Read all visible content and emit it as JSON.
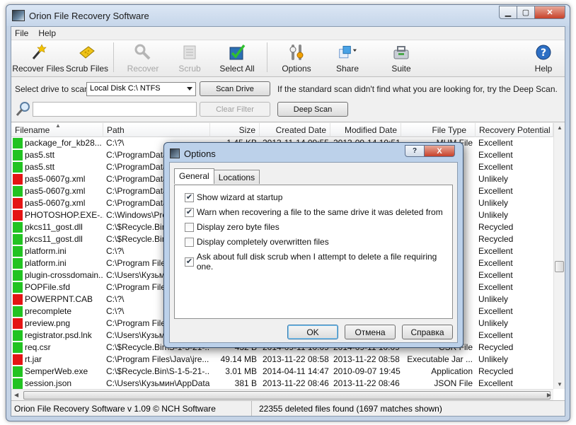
{
  "window": {
    "title": "Orion File Recovery Software"
  },
  "menu": [
    "File",
    "Help"
  ],
  "toolbar": {
    "recover_files": "Recover Files",
    "scrub_files": "Scrub Files",
    "recover": "Recover",
    "scrub": "Scrub",
    "select_all": "Select All",
    "options": "Options",
    "share": "Share",
    "suite": "Suite",
    "help": "Help"
  },
  "scan": {
    "drive_label": "Select drive to scan:",
    "drive_value": "Local Disk C:\\ NTFS",
    "scan_drive": "Scan Drive",
    "hint": "If the standard scan didn't find what you are looking for, try the Deep Scan.",
    "clear_filter": "Clear Filter",
    "deep_scan": "Deep Scan"
  },
  "table": {
    "columns": [
      "Filename",
      "Path",
      "Size",
      "Created Date",
      "Modified Date",
      "File Type",
      "Recovery Potential"
    ],
    "rows": [
      {
        "status": "green",
        "name": "package_for_kb28...",
        "path": "C:\\?\\",
        "size": "1.45 KB",
        "created": "2013-11-14 09:55",
        "modified": "2013-09-14 10:51",
        "type": "MUM File",
        "potential": "Excellent"
      },
      {
        "status": "green",
        "name": "pas5.stt",
        "path": "C:\\ProgramData",
        "size": "",
        "created": "",
        "modified": "",
        "type": "",
        "potential": "Excellent"
      },
      {
        "status": "green",
        "name": "pas5.stt",
        "path": "C:\\ProgramData",
        "size": "",
        "created": "",
        "modified": "",
        "type": "",
        "potential": "Excellent"
      },
      {
        "status": "red",
        "name": "pas5-0607g.xml",
        "path": "C:\\ProgramData",
        "size": "",
        "created": "",
        "modified": "",
        "type": "",
        "potential": "Unlikely"
      },
      {
        "status": "green",
        "name": "pas5-0607g.xml",
        "path": "C:\\ProgramData",
        "size": "",
        "created": "",
        "modified": "",
        "type": "",
        "potential": "Excellent"
      },
      {
        "status": "red",
        "name": "pas5-0607g.xml",
        "path": "C:\\ProgramData",
        "size": "",
        "created": "",
        "modified": "",
        "type": "",
        "potential": "Unlikely"
      },
      {
        "status": "red",
        "name": "PHOTOSHOP.EXE-...",
        "path": "C:\\Windows\\Pre",
        "size": "",
        "created": "",
        "modified": "",
        "type": "",
        "potential": "Unlikely"
      },
      {
        "status": "green",
        "name": "pkcs11_gost.dll",
        "path": "C:\\$Recycle.Bin",
        "size": "",
        "created": "",
        "modified": "",
        "type": "",
        "potential": "Recycled"
      },
      {
        "status": "green",
        "name": "pkcs11_gost.dll",
        "path": "C:\\$Recycle.Bin",
        "size": "",
        "created": "",
        "modified": "",
        "type": "",
        "potential": "Recycled"
      },
      {
        "status": "green",
        "name": "platform.ini",
        "path": "C:\\?\\",
        "size": "",
        "created": "",
        "modified": "",
        "type": "",
        "potential": "Excellent"
      },
      {
        "status": "green",
        "name": "platform.ini",
        "path": "C:\\Program Files",
        "size": "",
        "created": "",
        "modified": "",
        "type": "",
        "potential": "Excellent"
      },
      {
        "status": "green",
        "name": "plugin-crossdomain...",
        "path": "C:\\Users\\Кузьм",
        "size": "",
        "created": "",
        "modified": "",
        "type": "",
        "potential": "Excellent"
      },
      {
        "status": "green",
        "name": "POPFile.sfd",
        "path": "C:\\Program Files",
        "size": "",
        "created": "",
        "modified": "",
        "type": "",
        "potential": "Excellent"
      },
      {
        "status": "red",
        "name": "POWERPNT.CAB",
        "path": "C:\\?\\",
        "size": "",
        "created": "",
        "modified": "",
        "type": "",
        "potential": "Unlikely"
      },
      {
        "status": "green",
        "name": "precomplete",
        "path": "C:\\?\\",
        "size": "",
        "created": "",
        "modified": "",
        "type": "",
        "potential": "Excellent"
      },
      {
        "status": "red",
        "name": "preview.png",
        "path": "C:\\Program Files",
        "size": "",
        "created": "",
        "modified": "",
        "type": "",
        "potential": "Unlikely"
      },
      {
        "status": "green",
        "name": "registrator.psd.lnk",
        "path": "C:\\Users\\Кузьм",
        "size": "",
        "created": "",
        "modified": "",
        "type": "",
        "potential": "Excellent"
      },
      {
        "status": "green",
        "name": "req.csr",
        "path": "C:\\$Recycle.Bin\\S-1-5-21-...",
        "size": "432 B",
        "created": "2014-09-11 10:09",
        "modified": "2014-09-11 10:09",
        "type": "CSR File",
        "potential": "Recycled"
      },
      {
        "status": "red",
        "name": "rt.jar",
        "path": "C:\\Program Files\\Java\\jre...",
        "size": "49.14 MB",
        "created": "2013-11-22 08:58",
        "modified": "2013-11-22 08:58",
        "type": "Executable Jar ...",
        "potential": "Unlikely"
      },
      {
        "status": "green",
        "name": "SemperWeb.exe",
        "path": "C:\\$Recycle.Bin\\S-1-5-21-...",
        "size": "3.01 MB",
        "created": "2014-04-11 14:47",
        "modified": "2010-09-07 19:45",
        "type": "Application",
        "potential": "Recycled"
      },
      {
        "status": "green",
        "name": "session.json",
        "path": "C:\\Users\\Кузьмин\\AppData...",
        "size": "381 B",
        "created": "2013-11-22 08:46",
        "modified": "2013-11-22 08:46",
        "type": "JSON File",
        "potential": "Excellent"
      }
    ]
  },
  "status": {
    "left": "Orion File Recovery Software v 1.09 © NCH Software",
    "right": "22355 deleted files found (1697 matches shown)"
  },
  "dialog": {
    "title": "Options",
    "tabs": [
      "General",
      "Locations"
    ],
    "options": [
      {
        "label": "Show wizard at startup",
        "checked": true
      },
      {
        "label": "Warn when recovering a file to the same drive it was deleted from",
        "checked": true
      },
      {
        "label": "Display zero byte files",
        "checked": false
      },
      {
        "label": "Display completely overwritten files",
        "checked": false
      },
      {
        "label": "Ask about full disk scrub when I attempt to delete a file requiring one.",
        "checked": true
      }
    ],
    "ok": "OK",
    "cancel": "Отмена",
    "help": "Справка",
    "help_glyph": "?",
    "close_glyph": "X"
  },
  "colors": {
    "green": "#22c322",
    "red": "#e41414"
  }
}
